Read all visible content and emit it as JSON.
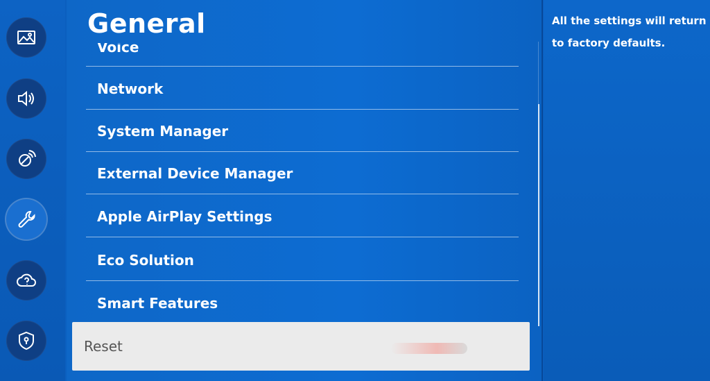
{
  "sidebar": {
    "icons": [
      {
        "name": "picture-icon",
        "active": false
      },
      {
        "name": "sound-icon",
        "active": false
      },
      {
        "name": "broadcasting-icon",
        "active": false
      },
      {
        "name": "general-wrench-icon",
        "active": true
      },
      {
        "name": "support-cloud-icon",
        "active": false
      },
      {
        "name": "privacy-shield-icon",
        "active": false
      }
    ]
  },
  "main": {
    "title": "General",
    "items": [
      {
        "label": "Voice"
      },
      {
        "label": "Network"
      },
      {
        "label": "System Manager"
      },
      {
        "label": "External Device Manager"
      },
      {
        "label": "Apple AirPlay Settings"
      },
      {
        "label": "Eco Solution"
      },
      {
        "label": "Smart Features"
      }
    ],
    "selected": {
      "label": "Reset"
    }
  },
  "panel": {
    "description": "All the settings will return to factory defaults."
  },
  "colors": {
    "background": "#0b5fbf",
    "selected_bg": "#ebebeb",
    "icon_circle": "#0f3f84"
  }
}
